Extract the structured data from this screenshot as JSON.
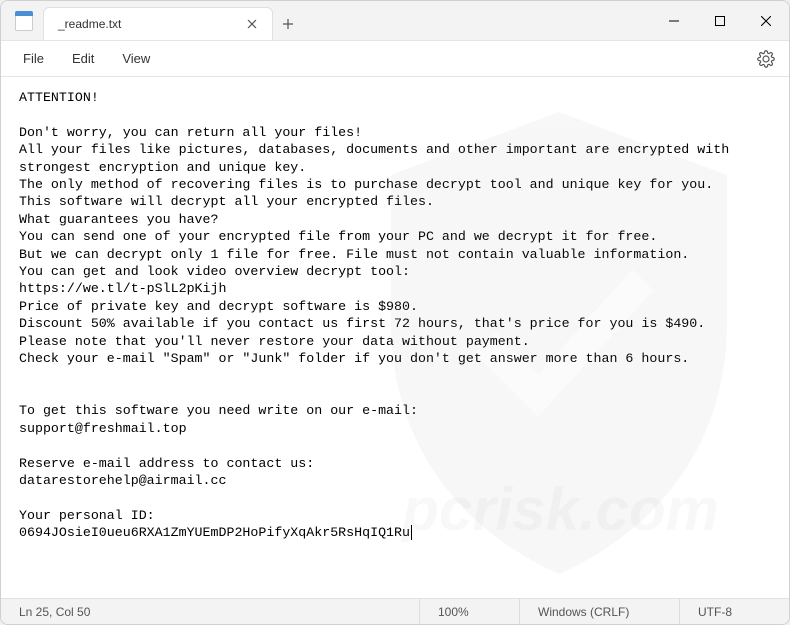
{
  "tab": {
    "title": "_readme.txt"
  },
  "menu": {
    "file": "File",
    "edit": "Edit",
    "view": "View"
  },
  "content": {
    "text": "ATTENTION!\n\nDon't worry, you can return all your files!\nAll your files like pictures, databases, documents and other important are encrypted with strongest encryption and unique key.\nThe only method of recovering files is to purchase decrypt tool and unique key for you.\nThis software will decrypt all your encrypted files.\nWhat guarantees you have?\nYou can send one of your encrypted file from your PC and we decrypt it for free.\nBut we can decrypt only 1 file for free. File must not contain valuable information.\nYou can get and look video overview decrypt tool:\nhttps://we.tl/t-pSlL2pKijh\nPrice of private key and decrypt software is $980.\nDiscount 50% available if you contact us first 72 hours, that's price for you is $490.\nPlease note that you'll never restore your data without payment.\nCheck your e-mail \"Spam\" or \"Junk\" folder if you don't get answer more than 6 hours.\n\n\nTo get this software you need write on our e-mail:\nsupport@freshmail.top\n\nReserve e-mail address to contact us:\ndatarestorehelp@airmail.cc\n\nYour personal ID:\n0694JOsieI0ueu6RXA1ZmYUEmDP2HoPifyXqAkr5RsHqIQ1Ru"
  },
  "status": {
    "position": "Ln 25, Col 50",
    "zoom": "100%",
    "lineending": "Windows (CRLF)",
    "encoding": "UTF-8"
  }
}
